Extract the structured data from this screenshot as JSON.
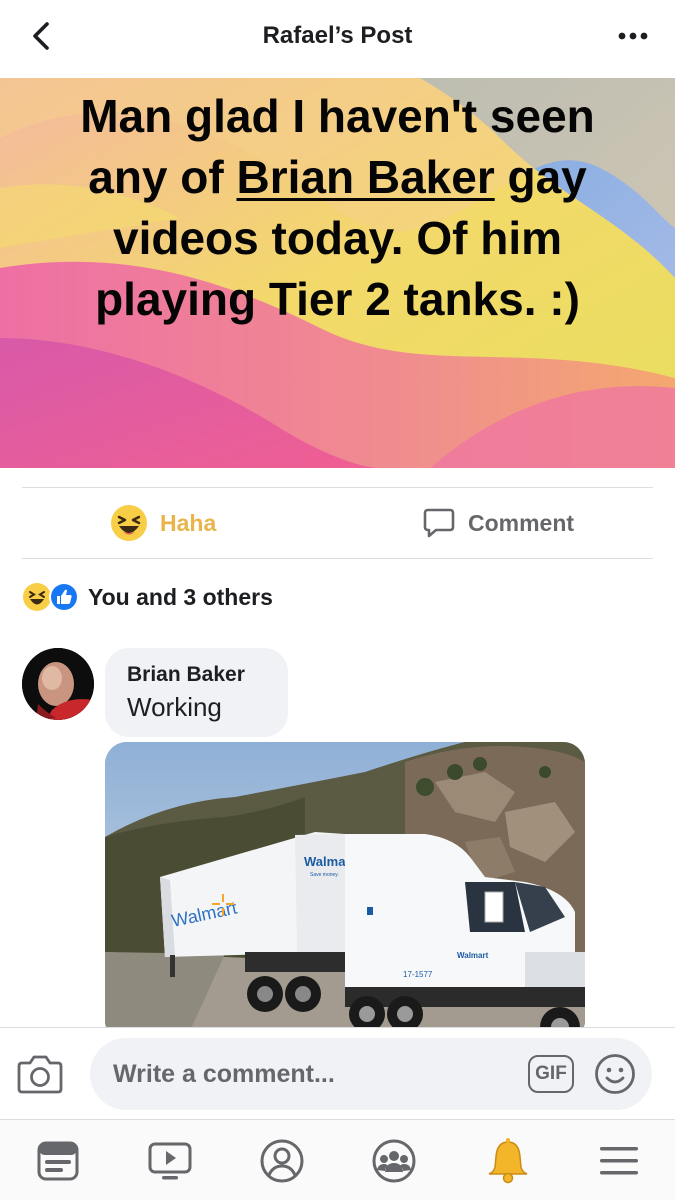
{
  "header": {
    "title": "Rafael’s Post",
    "back_icon": "chevron-left-icon",
    "more_icon": "more-dots-icon"
  },
  "post": {
    "text_parts": {
      "p1": "Man glad I haven't seen any of ",
      "tag": "Brian Baker",
      "p2": " gay videos today. Of him playing Tier 2 tanks. :)"
    },
    "background_colors": [
      "#f2b3a3",
      "#f6d75a",
      "#e9e35c",
      "#f07aa4",
      "#d65ab0",
      "#6fa7de"
    ]
  },
  "actions": {
    "haha_label": "Haha",
    "comment_label": "Comment",
    "haha_color": "#e9b54a"
  },
  "reactions": {
    "summary": "You and 3 others",
    "icons": [
      "haha-reaction-icon",
      "like-reaction-icon"
    ]
  },
  "comment": {
    "author": "Brian Baker",
    "text": "Working",
    "photo": {
      "trailer_brand": "Walmart",
      "trailer_side_text": "Walma",
      "tagline": "Save money.",
      "cab_brand": "Walmart",
      "cab_number": "17-1577"
    }
  },
  "composer": {
    "placeholder": "Write a comment...",
    "gif_label": "GIF"
  },
  "bottom_nav": {
    "items": [
      "news-feed-icon",
      "watch-video-icon",
      "profile-icon",
      "groups-icon",
      "notifications-bell-icon",
      "menu-icon"
    ]
  }
}
